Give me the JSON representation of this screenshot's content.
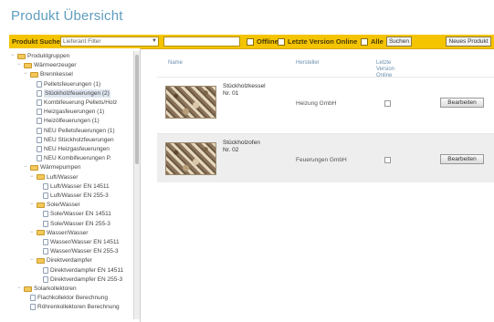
{
  "page": {
    "title": "Produkt Übersicht"
  },
  "toolbar": {
    "search_label": "Produkt Suche:",
    "category_select": "Lieferant Filter",
    "search_value": "",
    "offline_label": "Offline",
    "last_version_label": "Letzte Version Online",
    "all_label": "Alle",
    "search_button": "Suchen",
    "new_product_button": "Neues Produkt"
  },
  "tree": {
    "items": [
      {
        "label": "Produktgruppen",
        "type": "folder",
        "expanded": true,
        "level": 0
      },
      {
        "label": "Wärmeerzeuger",
        "type": "folder",
        "expanded": true,
        "level": 1
      },
      {
        "label": "Brennkessel",
        "type": "folder",
        "expanded": true,
        "level": 2
      },
      {
        "label": "Pelletsfeuerungen (1)",
        "type": "doc",
        "level": 3
      },
      {
        "label": "Stückholzfeuerungen (2)",
        "type": "doc",
        "level": 3,
        "selected": true
      },
      {
        "label": "Kombifeuerung Pellets/Holz",
        "type": "doc",
        "level": 3
      },
      {
        "label": "Heizgasfeuerungen (1)",
        "type": "doc",
        "level": 3
      },
      {
        "label": "Heizölfeuerungen (1)",
        "type": "doc",
        "level": 3
      },
      {
        "label": "NEU Pelletsfeuerungen (1)",
        "type": "doc",
        "level": 3
      },
      {
        "label": "NEU Stückholzfeuerungen",
        "type": "doc",
        "level": 3
      },
      {
        "label": "NEU Heizgasfeuerungen",
        "type": "doc",
        "level": 3
      },
      {
        "label": "NEU Kombifeuerungen P.",
        "type": "doc",
        "level": 3
      },
      {
        "label": "Wärmepumpen",
        "type": "folder",
        "expanded": true,
        "level": 2
      },
      {
        "label": "Luft/Wasser",
        "type": "folder",
        "expanded": true,
        "level": 3
      },
      {
        "label": "Luft/Wasser EN 14511",
        "type": "doc",
        "level": 4
      },
      {
        "label": "Luft/Wasser EN 255-3",
        "type": "doc",
        "level": 4
      },
      {
        "label": "Sole/Wasser",
        "type": "folder",
        "expanded": true,
        "level": 3
      },
      {
        "label": "Sole/Wasser EN 14511",
        "type": "doc",
        "level": 4
      },
      {
        "label": "Sole/Wasser EN 255-3",
        "type": "doc",
        "level": 4
      },
      {
        "label": "Wasser/Wasser",
        "type": "folder",
        "expanded": true,
        "level": 3
      },
      {
        "label": "Wasser/Wasser EN 14511",
        "type": "doc",
        "level": 4
      },
      {
        "label": "Wasser/Wasser EN 255-3",
        "type": "doc",
        "level": 4
      },
      {
        "label": "Direktverdampfer",
        "type": "folder",
        "expanded": true,
        "level": 3
      },
      {
        "label": "Direktverdampfer EN 14511",
        "type": "doc",
        "level": 4
      },
      {
        "label": "Direktverdampfer EN 255-3",
        "type": "doc",
        "level": 4
      },
      {
        "label": "Solarkollektoren",
        "type": "folder",
        "expanded": true,
        "level": 1
      },
      {
        "label": "Flachkollektor Berechnung",
        "type": "doc",
        "level": 2
      },
      {
        "label": "Röhrenkollektoren Berechnung",
        "type": "doc",
        "level": 2
      }
    ]
  },
  "table": {
    "headers": [
      "Name",
      "Hersteller",
      "Letzte Version Online"
    ],
    "rows": [
      {
        "name": "Stückholzkessel",
        "code": "Nr. 01",
        "maker": "Heizung GmbH",
        "action": "Bearbeiten"
      },
      {
        "name": "Stückholzofen",
        "code": "Nr. 02",
        "maker": "Feuerungen GmbH",
        "action": "Bearbeiten"
      }
    ]
  }
}
